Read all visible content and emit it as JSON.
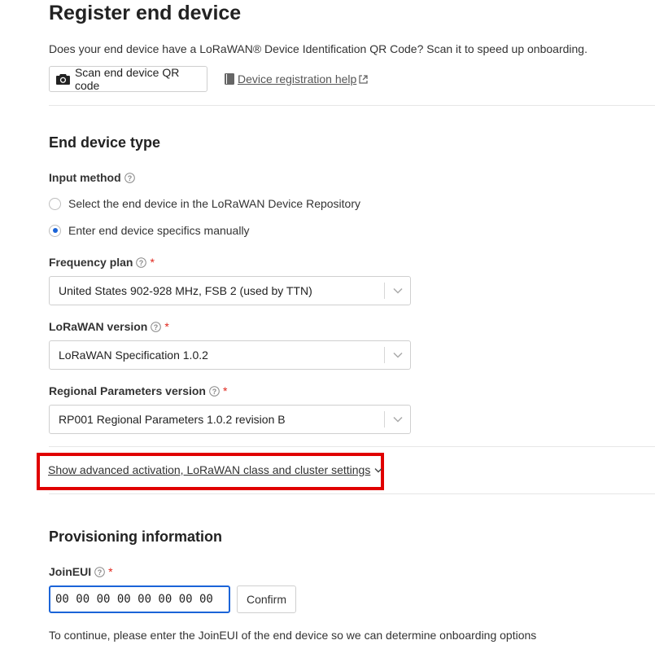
{
  "page": {
    "title": "Register end device",
    "qr_prompt": "Does your end device have a LoRaWAN® Device Identification QR Code? Scan it to speed up onboarding.",
    "scan_button": "Scan end device QR code",
    "help_link": "Device registration help"
  },
  "end_device_type": {
    "heading": "End device type",
    "input_method": {
      "label": "Input method",
      "options": [
        {
          "label": "Select the end device in the LoRaWAN Device Repository",
          "selected": false
        },
        {
          "label": "Enter end device specifics manually",
          "selected": true
        }
      ]
    },
    "frequency_plan": {
      "label": "Frequency plan",
      "required": "*",
      "value": "United States 902-928 MHz, FSB 2 (used by TTN)"
    },
    "lorawan_version": {
      "label": "LoRaWAN version",
      "required": "*",
      "value": "LoRaWAN Specification 1.0.2"
    },
    "regional_parameters": {
      "label": "Regional Parameters version",
      "required": "*",
      "value": "RP001 Regional Parameters 1.0.2 revision B"
    },
    "advanced_link": "Show advanced activation, LoRaWAN class and cluster settings"
  },
  "provisioning": {
    "heading": "Provisioning information",
    "joineui": {
      "label": "JoinEUI",
      "required": "*",
      "value": "00 00 00 00 00 00 00 00"
    },
    "confirm_button": "Confirm",
    "hint": "To continue, please enter the JoinEUI of the end device so we can determine onboarding options"
  },
  "colors": {
    "accent": "#1b64d8",
    "required": "#e0251b",
    "highlight_box": "#e00000"
  }
}
